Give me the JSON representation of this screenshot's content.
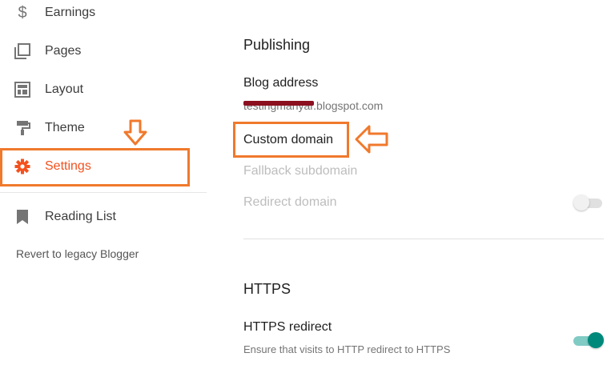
{
  "sidebar": {
    "items": [
      {
        "label": "Earnings",
        "icon": "dollar-icon"
      },
      {
        "label": "Pages",
        "icon": "pages-icon"
      },
      {
        "label": "Layout",
        "icon": "layout-icon"
      },
      {
        "label": "Theme",
        "icon": "paint-roller-icon"
      },
      {
        "label": "Settings",
        "icon": "gear-icon",
        "active": true
      },
      {
        "label": "Reading List",
        "icon": "bookmark-icon"
      }
    ],
    "legacy_link": "Revert to legacy Blogger"
  },
  "publishing": {
    "title": "Publishing",
    "blog_address_label": "Blog address",
    "blog_address_value": "testingmanyar.blogspot.com",
    "custom_domain_label": "Custom domain",
    "fallback_subdomain_label": "Fallback subdomain",
    "redirect_domain_label": "Redirect domain",
    "redirect_domain_enabled": false
  },
  "https": {
    "title": "HTTPS",
    "redirect_label": "HTTPS redirect",
    "redirect_description": "Ensure that visits to HTTP redirect to HTTPS",
    "redirect_enabled": true
  },
  "colors": {
    "accent": "#f4511e",
    "annotation": "#f0792c",
    "toggle_on": "#00897b"
  }
}
